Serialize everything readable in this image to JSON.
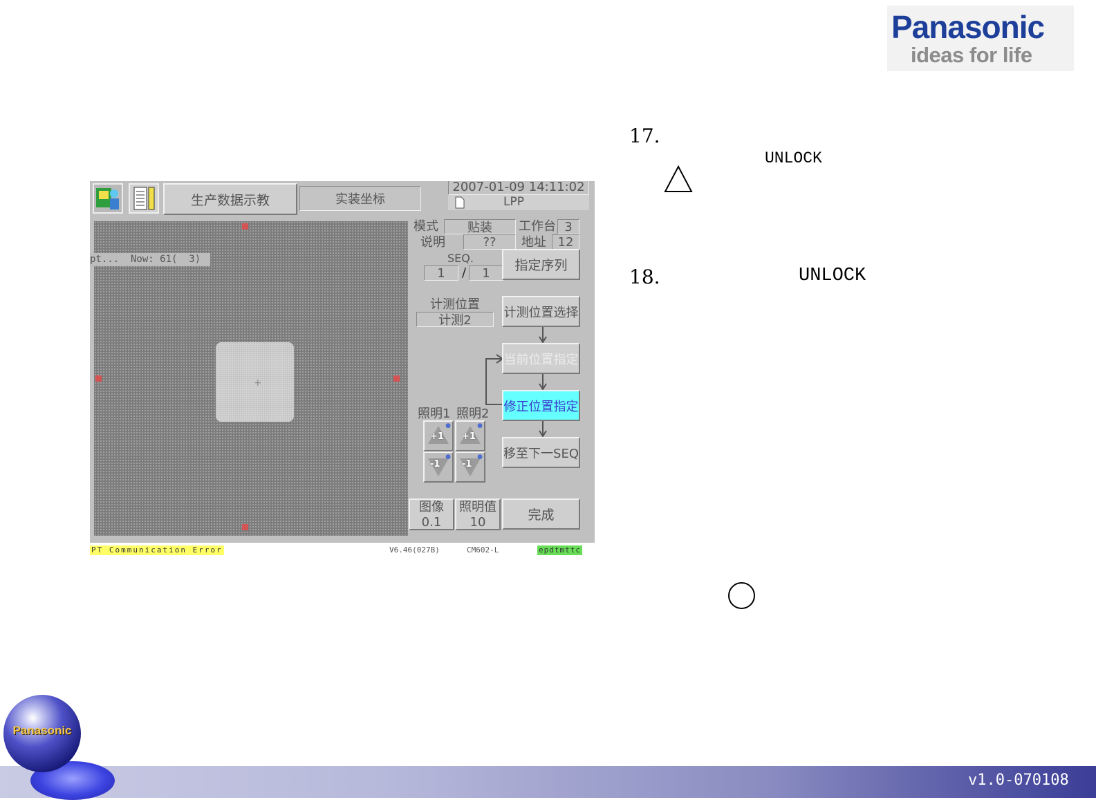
{
  "brand": {
    "name": "Panasonic",
    "tagline": "ideas for life"
  },
  "steps": [
    {
      "number": "17.",
      "keyword": "UNLOCK"
    },
    {
      "number": "18.",
      "keyword": "UNLOCK"
    }
  ],
  "screen": {
    "toolbar": {
      "tab_teach": "生产数据示教",
      "tab_coord": "实装坐标"
    },
    "datetime": "2007-01-09  14:11:02",
    "file_label": "LPP",
    "image_overlay": "pt...  Now: 61(  3)",
    "info": {
      "mode_label": "模式",
      "mode_value": "贴装",
      "table_label": "工作台",
      "table_value": "3",
      "desc_label": "说明",
      "desc_value": "??",
      "addr_label": "地址",
      "addr_value": "12",
      "seq_label": "SEQ.",
      "seq_current": "1",
      "seq_sep": "/",
      "seq_total": "1"
    },
    "buttons": {
      "specify_seq": "指定序列",
      "measure_select": "计测位置选择",
      "current_pos": "当前位置指定",
      "correct_pos": "修正位置指定",
      "next_seq": "移至下一SEQ",
      "done": "完成"
    },
    "measure": {
      "label": "计测位置",
      "value": "计测2"
    },
    "lighting": {
      "label1": "照明1",
      "label2": "照明2",
      "plus": "+1",
      "minus": "-1"
    },
    "image_box": {
      "label": "图像",
      "value": "0.1"
    },
    "light_value_box": {
      "label": "照明值",
      "value": "10"
    },
    "status": {
      "error": "PT Communication Error",
      "version": "V6.46(027B)",
      "model": "CM602-L",
      "host": "epdtmttc"
    },
    "colors": {
      "active_button": "#66ffff",
      "error_bg": "#ffff66",
      "host_bg": "#66dd55"
    }
  },
  "footer": {
    "version": "v1.0-070108",
    "globe_logo": "Panasonic"
  }
}
